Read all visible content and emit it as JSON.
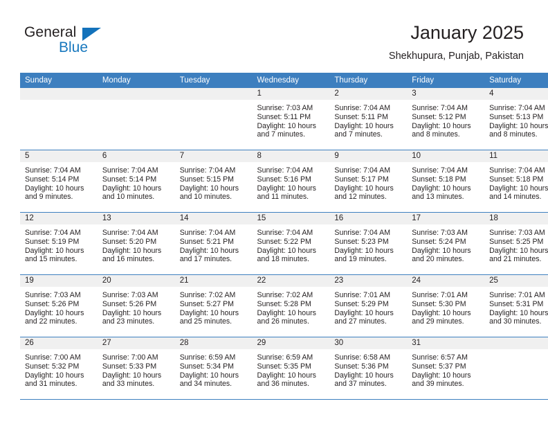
{
  "brand": {
    "name_part1": "General",
    "name_part2": "Blue",
    "triangle_color": "#1372bb",
    "blue_text_color": "#1878be"
  },
  "header": {
    "month_title": "January 2025",
    "location": "Shekhupura, Punjab, Pakistan"
  },
  "theme": {
    "header_blue": "#3d7fbf",
    "daynum_band": "#f0f0f0",
    "text": "#231f20"
  },
  "calendar": {
    "weekday_headers": [
      "Sunday",
      "Monday",
      "Tuesday",
      "Wednesday",
      "Thursday",
      "Friday",
      "Saturday"
    ],
    "weeks": [
      [
        {
          "day": "",
          "sunrise": "",
          "sunset": "",
          "daylight1": "",
          "daylight2": ""
        },
        {
          "day": "",
          "sunrise": "",
          "sunset": "",
          "daylight1": "",
          "daylight2": ""
        },
        {
          "day": "",
          "sunrise": "",
          "sunset": "",
          "daylight1": "",
          "daylight2": ""
        },
        {
          "day": "1",
          "sunrise": "Sunrise: 7:03 AM",
          "sunset": "Sunset: 5:11 PM",
          "daylight1": "Daylight: 10 hours",
          "daylight2": "and 7 minutes."
        },
        {
          "day": "2",
          "sunrise": "Sunrise: 7:04 AM",
          "sunset": "Sunset: 5:11 PM",
          "daylight1": "Daylight: 10 hours",
          "daylight2": "and 7 minutes."
        },
        {
          "day": "3",
          "sunrise": "Sunrise: 7:04 AM",
          "sunset": "Sunset: 5:12 PM",
          "daylight1": "Daylight: 10 hours",
          "daylight2": "and 8 minutes."
        },
        {
          "day": "4",
          "sunrise": "Sunrise: 7:04 AM",
          "sunset": "Sunset: 5:13 PM",
          "daylight1": "Daylight: 10 hours",
          "daylight2": "and 8 minutes."
        }
      ],
      [
        {
          "day": "5",
          "sunrise": "Sunrise: 7:04 AM",
          "sunset": "Sunset: 5:14 PM",
          "daylight1": "Daylight: 10 hours",
          "daylight2": "and 9 minutes."
        },
        {
          "day": "6",
          "sunrise": "Sunrise: 7:04 AM",
          "sunset": "Sunset: 5:14 PM",
          "daylight1": "Daylight: 10 hours",
          "daylight2": "and 10 minutes."
        },
        {
          "day": "7",
          "sunrise": "Sunrise: 7:04 AM",
          "sunset": "Sunset: 5:15 PM",
          "daylight1": "Daylight: 10 hours",
          "daylight2": "and 10 minutes."
        },
        {
          "day": "8",
          "sunrise": "Sunrise: 7:04 AM",
          "sunset": "Sunset: 5:16 PM",
          "daylight1": "Daylight: 10 hours",
          "daylight2": "and 11 minutes."
        },
        {
          "day": "9",
          "sunrise": "Sunrise: 7:04 AM",
          "sunset": "Sunset: 5:17 PM",
          "daylight1": "Daylight: 10 hours",
          "daylight2": "and 12 minutes."
        },
        {
          "day": "10",
          "sunrise": "Sunrise: 7:04 AM",
          "sunset": "Sunset: 5:18 PM",
          "daylight1": "Daylight: 10 hours",
          "daylight2": "and 13 minutes."
        },
        {
          "day": "11",
          "sunrise": "Sunrise: 7:04 AM",
          "sunset": "Sunset: 5:18 PM",
          "daylight1": "Daylight: 10 hours",
          "daylight2": "and 14 minutes."
        }
      ],
      [
        {
          "day": "12",
          "sunrise": "Sunrise: 7:04 AM",
          "sunset": "Sunset: 5:19 PM",
          "daylight1": "Daylight: 10 hours",
          "daylight2": "and 15 minutes."
        },
        {
          "day": "13",
          "sunrise": "Sunrise: 7:04 AM",
          "sunset": "Sunset: 5:20 PM",
          "daylight1": "Daylight: 10 hours",
          "daylight2": "and 16 minutes."
        },
        {
          "day": "14",
          "sunrise": "Sunrise: 7:04 AM",
          "sunset": "Sunset: 5:21 PM",
          "daylight1": "Daylight: 10 hours",
          "daylight2": "and 17 minutes."
        },
        {
          "day": "15",
          "sunrise": "Sunrise: 7:04 AM",
          "sunset": "Sunset: 5:22 PM",
          "daylight1": "Daylight: 10 hours",
          "daylight2": "and 18 minutes."
        },
        {
          "day": "16",
          "sunrise": "Sunrise: 7:04 AM",
          "sunset": "Sunset: 5:23 PM",
          "daylight1": "Daylight: 10 hours",
          "daylight2": "and 19 minutes."
        },
        {
          "day": "17",
          "sunrise": "Sunrise: 7:03 AM",
          "sunset": "Sunset: 5:24 PM",
          "daylight1": "Daylight: 10 hours",
          "daylight2": "and 20 minutes."
        },
        {
          "day": "18",
          "sunrise": "Sunrise: 7:03 AM",
          "sunset": "Sunset: 5:25 PM",
          "daylight1": "Daylight: 10 hours",
          "daylight2": "and 21 minutes."
        }
      ],
      [
        {
          "day": "19",
          "sunrise": "Sunrise: 7:03 AM",
          "sunset": "Sunset: 5:26 PM",
          "daylight1": "Daylight: 10 hours",
          "daylight2": "and 22 minutes."
        },
        {
          "day": "20",
          "sunrise": "Sunrise: 7:03 AM",
          "sunset": "Sunset: 5:26 PM",
          "daylight1": "Daylight: 10 hours",
          "daylight2": "and 23 minutes."
        },
        {
          "day": "21",
          "sunrise": "Sunrise: 7:02 AM",
          "sunset": "Sunset: 5:27 PM",
          "daylight1": "Daylight: 10 hours",
          "daylight2": "and 25 minutes."
        },
        {
          "day": "22",
          "sunrise": "Sunrise: 7:02 AM",
          "sunset": "Sunset: 5:28 PM",
          "daylight1": "Daylight: 10 hours",
          "daylight2": "and 26 minutes."
        },
        {
          "day": "23",
          "sunrise": "Sunrise: 7:01 AM",
          "sunset": "Sunset: 5:29 PM",
          "daylight1": "Daylight: 10 hours",
          "daylight2": "and 27 minutes."
        },
        {
          "day": "24",
          "sunrise": "Sunrise: 7:01 AM",
          "sunset": "Sunset: 5:30 PM",
          "daylight1": "Daylight: 10 hours",
          "daylight2": "and 29 minutes."
        },
        {
          "day": "25",
          "sunrise": "Sunrise: 7:01 AM",
          "sunset": "Sunset: 5:31 PM",
          "daylight1": "Daylight: 10 hours",
          "daylight2": "and 30 minutes."
        }
      ],
      [
        {
          "day": "26",
          "sunrise": "Sunrise: 7:00 AM",
          "sunset": "Sunset: 5:32 PM",
          "daylight1": "Daylight: 10 hours",
          "daylight2": "and 31 minutes."
        },
        {
          "day": "27",
          "sunrise": "Sunrise: 7:00 AM",
          "sunset": "Sunset: 5:33 PM",
          "daylight1": "Daylight: 10 hours",
          "daylight2": "and 33 minutes."
        },
        {
          "day": "28",
          "sunrise": "Sunrise: 6:59 AM",
          "sunset": "Sunset: 5:34 PM",
          "daylight1": "Daylight: 10 hours",
          "daylight2": "and 34 minutes."
        },
        {
          "day": "29",
          "sunrise": "Sunrise: 6:59 AM",
          "sunset": "Sunset: 5:35 PM",
          "daylight1": "Daylight: 10 hours",
          "daylight2": "and 36 minutes."
        },
        {
          "day": "30",
          "sunrise": "Sunrise: 6:58 AM",
          "sunset": "Sunset: 5:36 PM",
          "daylight1": "Daylight: 10 hours",
          "daylight2": "and 37 minutes."
        },
        {
          "day": "31",
          "sunrise": "Sunrise: 6:57 AM",
          "sunset": "Sunset: 5:37 PM",
          "daylight1": "Daylight: 10 hours",
          "daylight2": "and 39 minutes."
        },
        {
          "day": "",
          "sunrise": "",
          "sunset": "",
          "daylight1": "",
          "daylight2": ""
        }
      ]
    ]
  }
}
